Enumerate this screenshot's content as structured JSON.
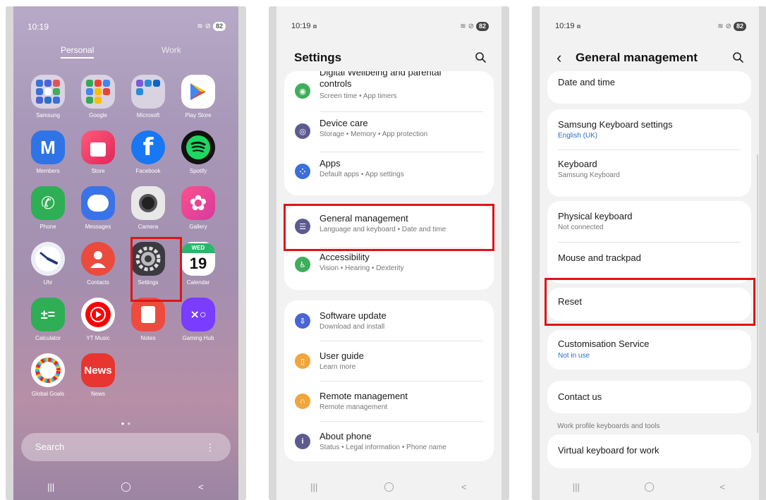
{
  "panel1": {
    "status": {
      "time": "10:19",
      "battery": "82"
    },
    "tabs": {
      "personal": "Personal",
      "work": "Work"
    },
    "apps": [
      {
        "label": "Samsung"
      },
      {
        "label": "Google"
      },
      {
        "label": "Microsoft"
      },
      {
        "label": "Play Store"
      },
      {
        "label": "Members",
        "glyph": "M"
      },
      {
        "label": "Store"
      },
      {
        "label": "Facebook",
        "glyph": "f"
      },
      {
        "label": "Spotify"
      },
      {
        "label": "Phone"
      },
      {
        "label": "Messages"
      },
      {
        "label": "Camera"
      },
      {
        "label": "Gallery"
      },
      {
        "label": "Uhr"
      },
      {
        "label": "Contacts"
      },
      {
        "label": "Settings"
      },
      {
        "label": "Calendar",
        "day": "WED",
        "date": "19"
      },
      {
        "label": "Calculator"
      },
      {
        "label": "YT Music"
      },
      {
        "label": "Notes"
      },
      {
        "label": "Gaming Hub"
      },
      {
        "label": "Global Goals"
      },
      {
        "label": "News",
        "glyph": "News"
      }
    ],
    "search_placeholder": "Search"
  },
  "panel2": {
    "status": {
      "time": "10:19",
      "battery": "82"
    },
    "title": "Settings",
    "groups": [
      [
        {
          "title": "Digital Wellbeing and parental controls",
          "title_line1": "Digital Wellbeing and parental",
          "title_line2": "controls",
          "subtitle": "Screen time • App timers",
          "icon": "wellbeing-icon",
          "color": "#3fae5c"
        },
        {
          "title": "Device care",
          "subtitle": "Storage • Memory • App protection",
          "icon": "device-care-icon",
          "color": "#5c5a8e"
        },
        {
          "title": "Apps",
          "subtitle": "Default apps • App settings",
          "icon": "apps-icon",
          "color": "#3b6fd9"
        }
      ],
      [
        {
          "title": "General management",
          "subtitle": "Language and keyboard • Date and time",
          "icon": "general-management-icon",
          "color": "#5c5a8e"
        },
        {
          "title": "Accessibility",
          "subtitle": "Vision • Hearing • Dexterity",
          "icon": "accessibility-icon",
          "color": "#3fae5c"
        }
      ],
      [
        {
          "title": "Software update",
          "subtitle": "Download and install",
          "icon": "software-update-icon",
          "color": "#4a63d6"
        },
        {
          "title": "User guide",
          "subtitle": "Learn more",
          "icon": "user-guide-icon",
          "color": "#f0a63a"
        },
        {
          "title": "Remote management",
          "subtitle": "Remote management",
          "icon": "remote-management-icon",
          "color": "#f0a63a"
        },
        {
          "title": "About phone",
          "subtitle": "Status • Legal information • Phone name",
          "icon": "about-phone-icon",
          "color": "#5c5a8e"
        }
      ]
    ]
  },
  "panel3": {
    "status": {
      "time": "10:19",
      "battery": "82"
    },
    "title": "General management",
    "items": {
      "date_time": "Date and time",
      "samsung_keyboard": {
        "title": "Samsung Keyboard settings",
        "subtitle": "English (UK)"
      },
      "keyboard": {
        "title": "Keyboard",
        "subtitle": "Samsung Keyboard"
      },
      "physical_keyboard": {
        "title": "Physical keyboard",
        "subtitle": "Not connected"
      },
      "mouse": "Mouse and trackpad",
      "reset": "Reset",
      "customisation": {
        "title": "Customisation Service",
        "subtitle": "Not in use"
      },
      "contact": "Contact us",
      "work_section": "Work profile keyboards and tools",
      "virtual_keyboard": "Virtual keyboard for work"
    }
  },
  "colors": {
    "highlight": "#e01414",
    "link_blue": "#2a6fc9"
  }
}
